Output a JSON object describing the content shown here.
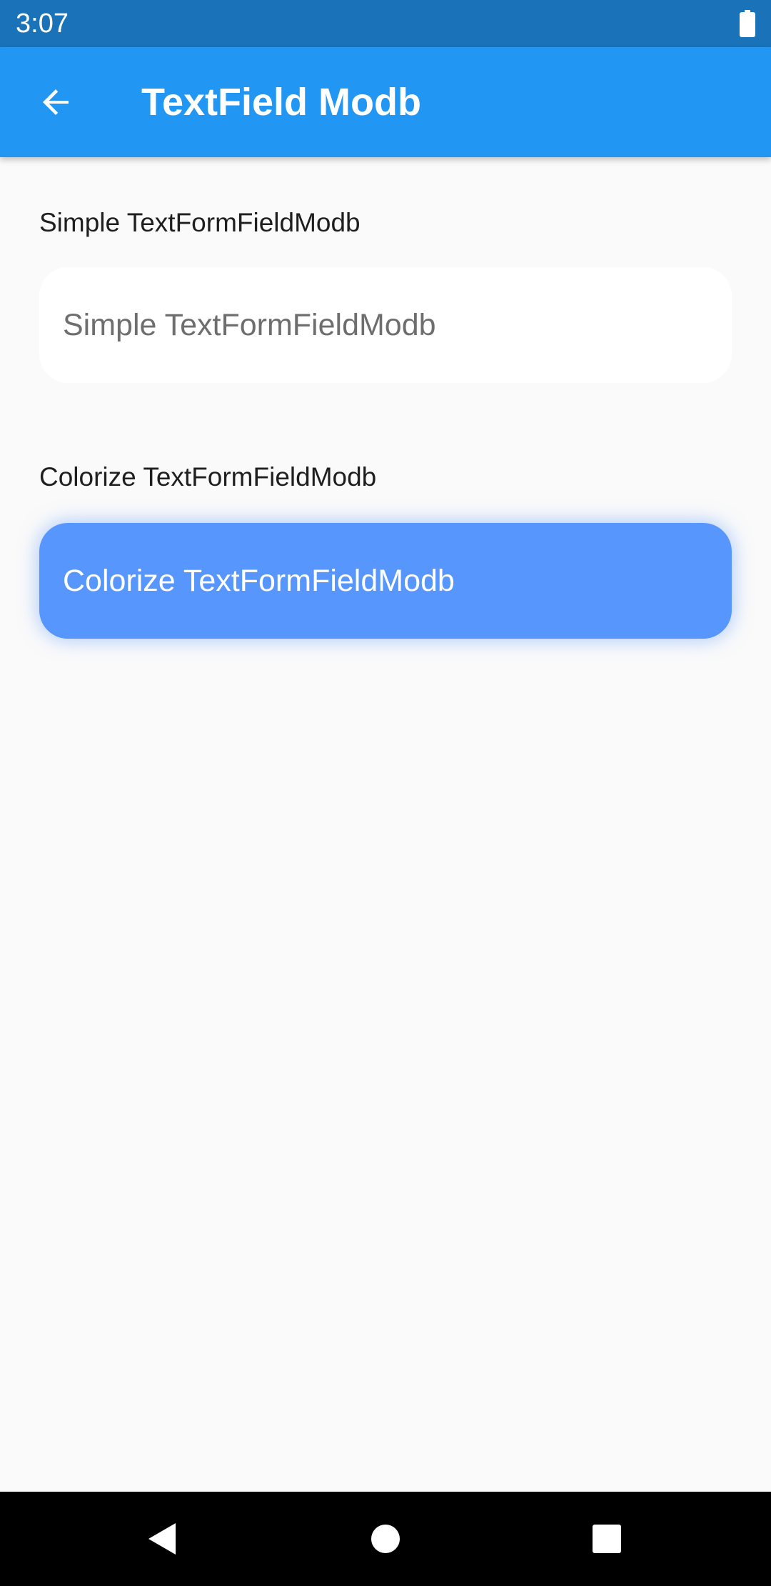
{
  "status_bar": {
    "time": "3:07",
    "battery_icon": "battery-full-icon"
  },
  "app_bar": {
    "title": "TextField Modb",
    "back_icon": "arrow-back-icon",
    "background_color": "#2196f3"
  },
  "sections": [
    {
      "label": "Simple TextFormFieldModb",
      "placeholder": "Simple TextFormFieldModb",
      "background_color": "#ffffff"
    },
    {
      "label": "Colorize TextFormFieldModb",
      "placeholder": "Colorize TextFormFieldModb",
      "background_color": "#5796fc"
    }
  ],
  "nav_bar": {
    "back_icon": "nav-back-triangle-icon",
    "home_icon": "nav-home-circle-icon",
    "recents_icon": "nav-recents-square-icon"
  }
}
